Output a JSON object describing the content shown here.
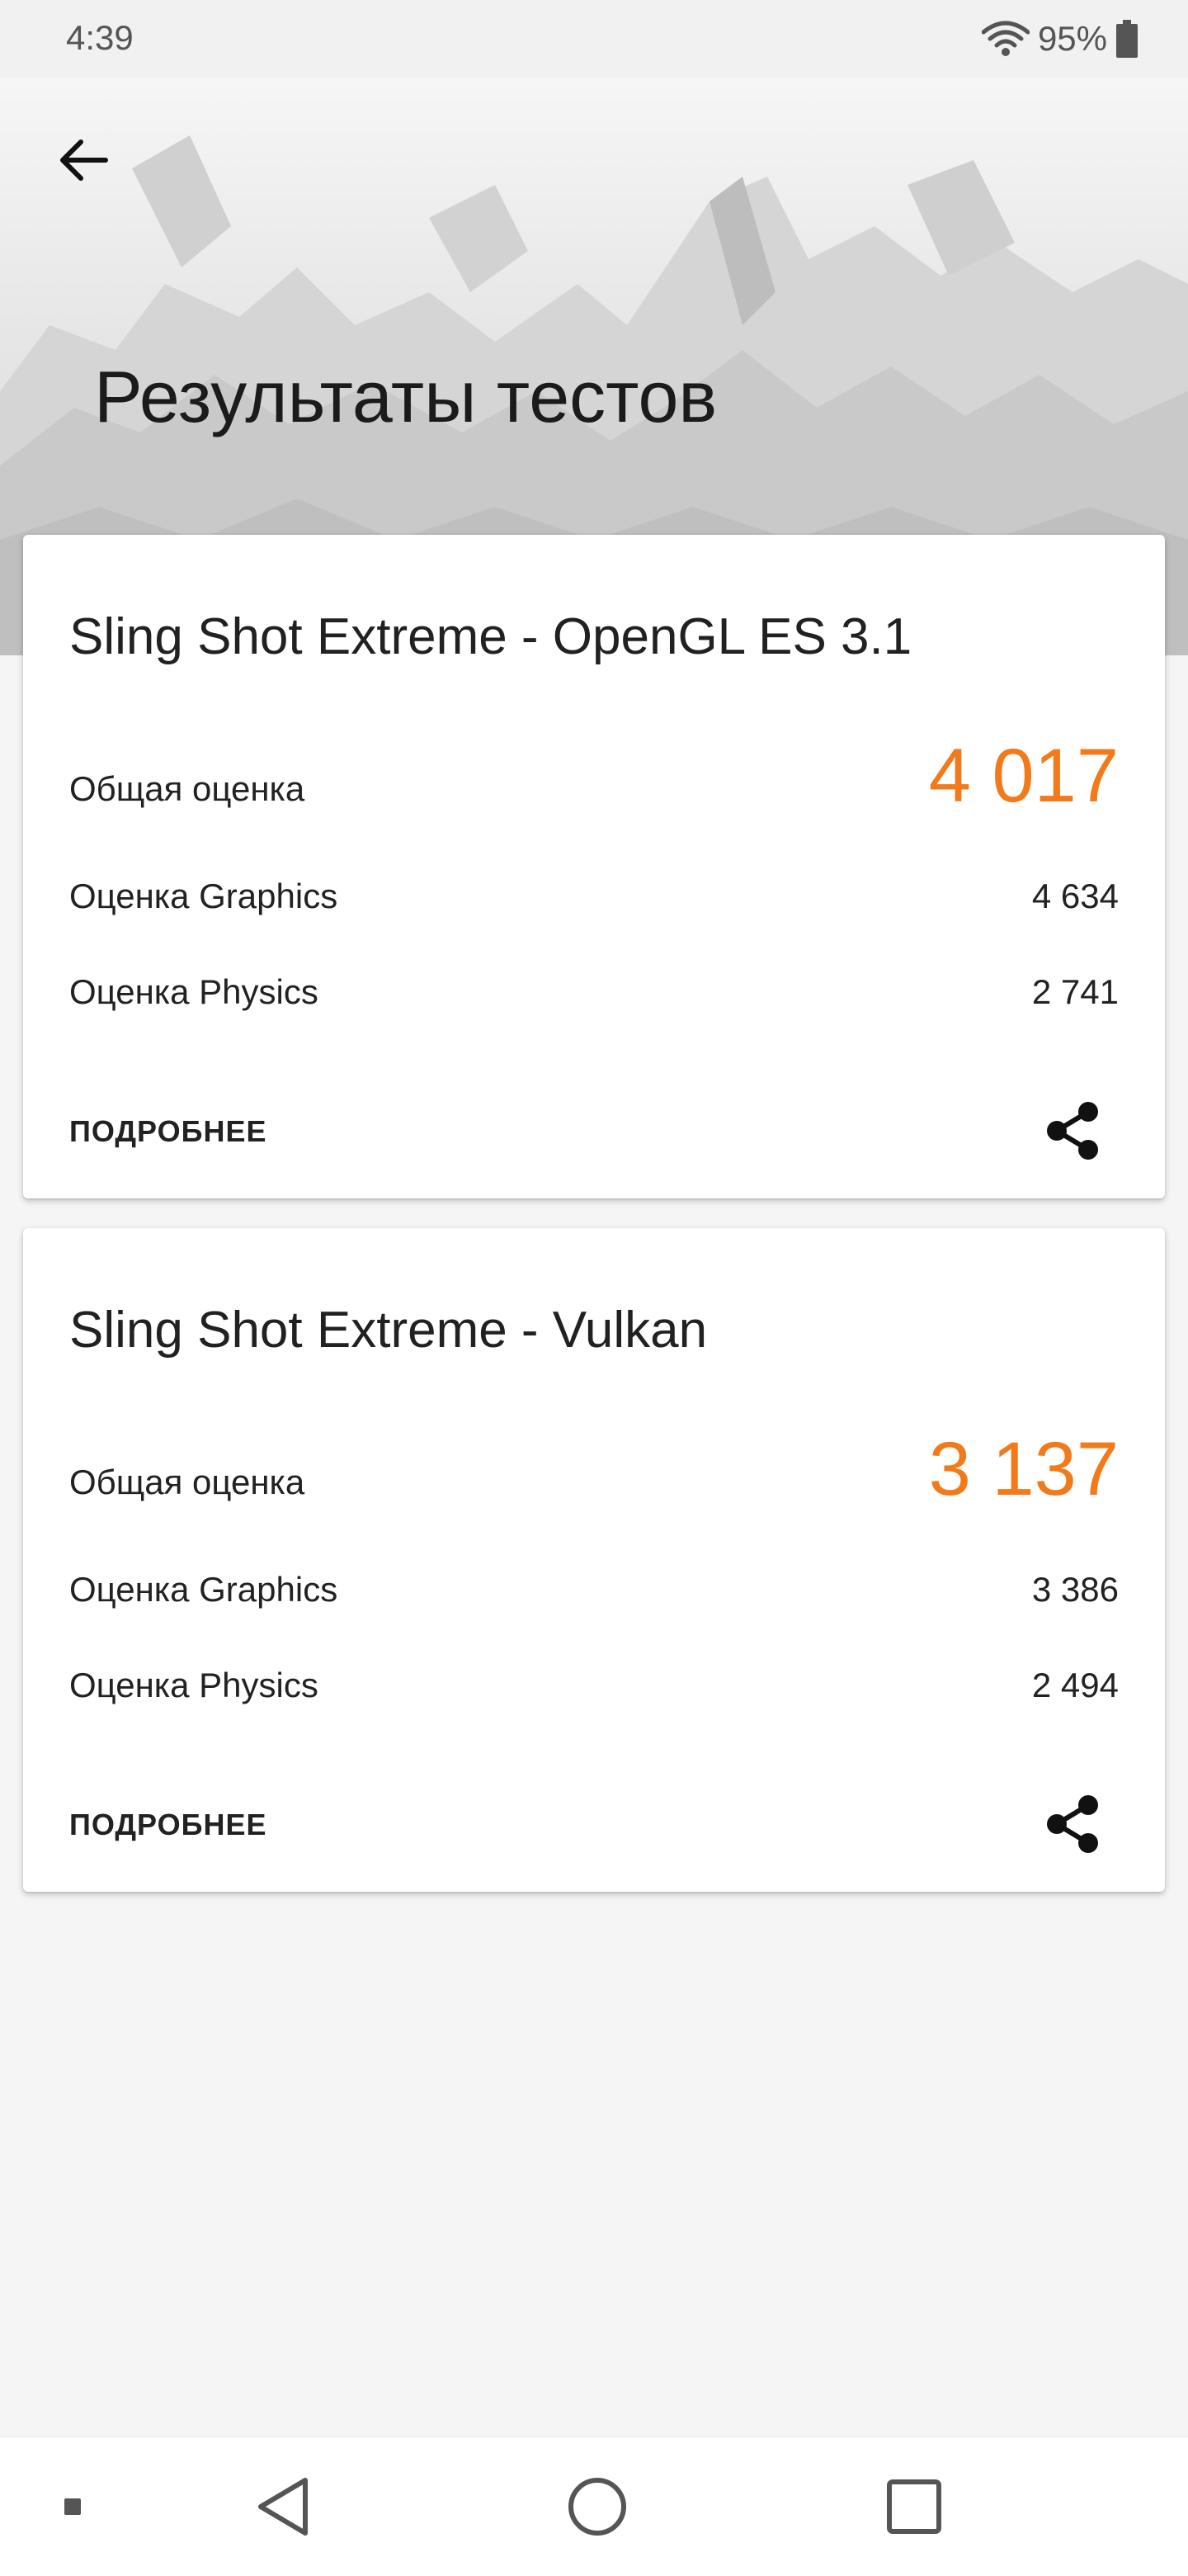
{
  "status_bar": {
    "time": "4:39",
    "battery_percent": "95%",
    "icons": [
      "wifi-icon",
      "battery-icon"
    ]
  },
  "header": {
    "back_icon": "arrow-left-icon",
    "title": "Результаты тестов"
  },
  "results": [
    {
      "title": "Sling Shot Extreme - OpenGL ES 3.1",
      "overall_label": "Общая оценка",
      "overall_value": "4 017",
      "graphics_label": "Оценка Graphics",
      "graphics_value": "4 634",
      "physics_label": "Оценка Physics",
      "physics_value": "2 741",
      "details_label": "ПОДРОБНЕЕ",
      "share_icon": "share-icon"
    },
    {
      "title": "Sling Shot Extreme - Vulkan",
      "overall_label": "Общая оценка",
      "overall_value": "3 137",
      "graphics_label": "Оценка Graphics",
      "graphics_value": "3 386",
      "physics_label": "Оценка Physics",
      "physics_value": "2 494",
      "details_label": "ПОДРОБНЕЕ",
      "share_icon": "share-icon"
    }
  ],
  "navigation_bar": {
    "icons": [
      "dot-icon",
      "back-triangle-icon",
      "home-circle-icon",
      "recents-square-icon"
    ]
  },
  "colors": {
    "accent": "#f27a1a",
    "background": "#f5f5f5",
    "card": "#ffffff",
    "text": "#212121"
  }
}
